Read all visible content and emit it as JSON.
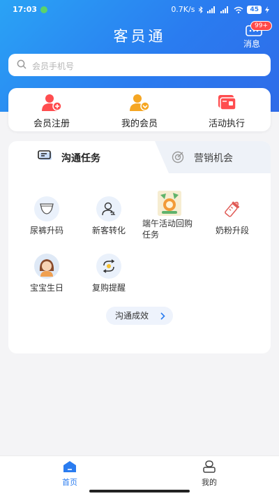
{
  "status": {
    "time": "17:03",
    "speed": "0.7K/s",
    "battery": "45"
  },
  "header": {
    "title": "客员通",
    "messages_label": "消息",
    "messages_badge": "99+"
  },
  "search": {
    "placeholder": "会员手机号"
  },
  "quick_actions": [
    {
      "label": "会员注册",
      "icon": "member-register-icon"
    },
    {
      "label": "我的会员",
      "icon": "my-members-icon"
    },
    {
      "label": "活动执行",
      "icon": "activity-icon"
    }
  ],
  "tabs": [
    {
      "label": "沟通任务",
      "active": true,
      "icon": "chat-icon"
    },
    {
      "label": "营销机会",
      "active": false,
      "icon": "target-icon"
    }
  ],
  "tasks": [
    {
      "label": "尿裤升码",
      "icon": "diaper-icon"
    },
    {
      "label": "新客转化",
      "icon": "new-customer-icon"
    },
    {
      "label": "端午活动回购任务",
      "line1": "端午活动回购",
      "line2": "任务",
      "icon": "dragon-boat-image"
    },
    {
      "label": "奶粉升段",
      "icon": "baby-bottle-icon"
    },
    {
      "label": "宝宝生日",
      "icon": "baby-avatar"
    },
    {
      "label": "复购提醒",
      "icon": "repurchase-icon"
    }
  ],
  "effect_button": {
    "label": "沟通成效"
  },
  "bottom_nav": [
    {
      "label": "首页",
      "active": true,
      "icon": "home-icon"
    },
    {
      "label": "我的",
      "active": false,
      "icon": "profile-icon"
    }
  ],
  "colors": {
    "primary": "#2a7cf0",
    "accent_red": "#ff4949",
    "orange": "#f5a623"
  }
}
